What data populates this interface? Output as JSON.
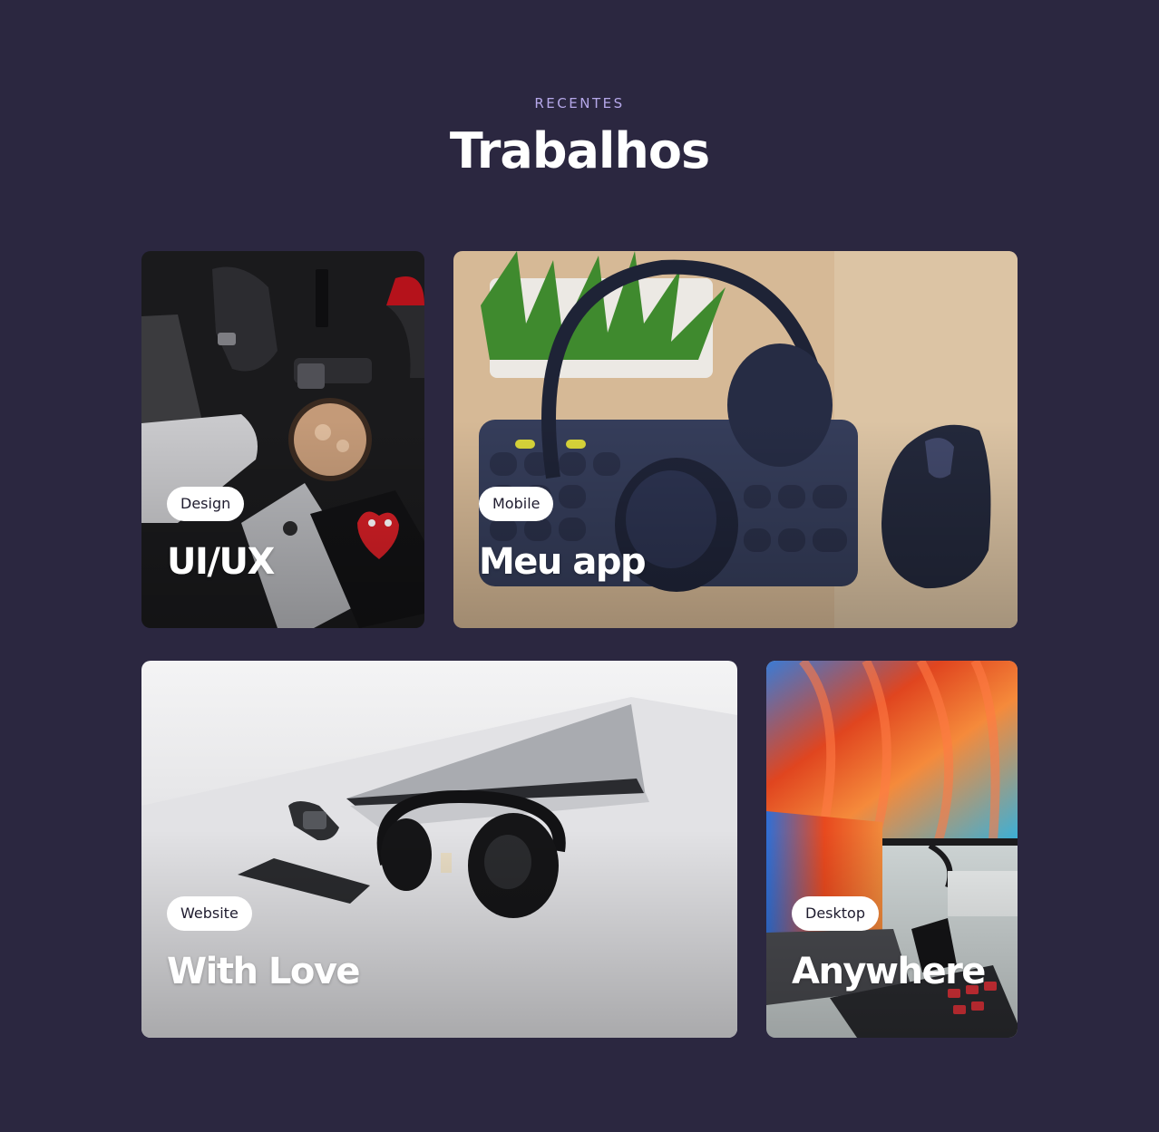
{
  "section": {
    "eyebrow": "RECENTES",
    "title": "Trabalhos"
  },
  "projects": [
    {
      "tag": "Design",
      "title": "UI/UX"
    },
    {
      "tag": "Mobile",
      "title": "Meu app"
    },
    {
      "tag": "Website",
      "title": "With Love"
    },
    {
      "tag": "Desktop",
      "title": "Anywhere"
    }
  ],
  "colors": {
    "background": "#2b2740",
    "eyebrow": "#b6a8ea",
    "tag_background": "#ffffff",
    "title_text": "#ffffff"
  }
}
